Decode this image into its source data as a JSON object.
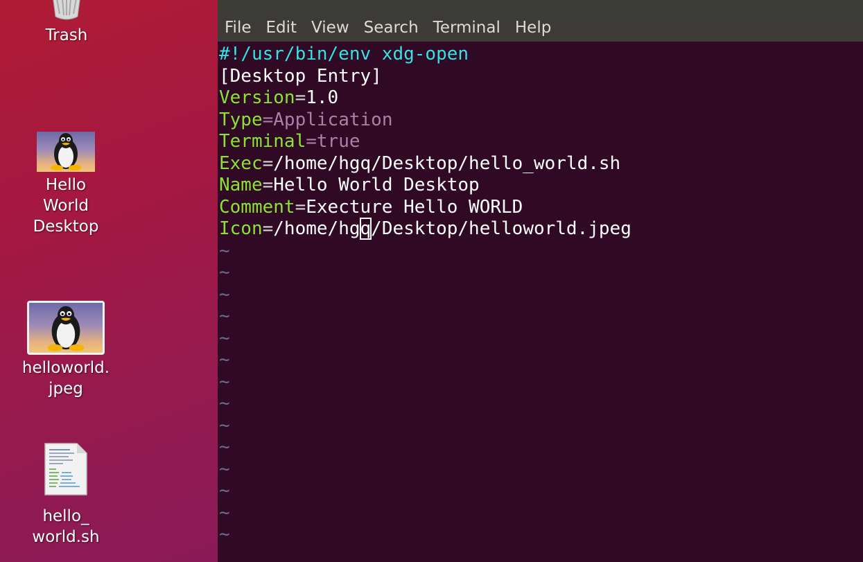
{
  "desktop": {
    "icons": [
      {
        "label": "Trash",
        "icon": "trash-icon"
      },
      {
        "label": "Hello\nWorld\nDesktop",
        "icon": "tux-icon"
      },
      {
        "label": "helloworld.\njpeg",
        "icon": "tux-icon"
      },
      {
        "label": "hello_\nworld.sh",
        "icon": "text-file-icon"
      }
    ]
  },
  "terminal": {
    "menu": [
      "File",
      "Edit",
      "View",
      "Search",
      "Terminal",
      "Help"
    ],
    "lines": [
      {
        "type": "shebang",
        "text": "#!/usr/bin/env xdg-open"
      },
      {
        "type": "plain",
        "text": "[Desktop Entry]"
      },
      {
        "type": "kv",
        "key": "Version",
        "value": "1.0"
      },
      {
        "type": "kv-purple",
        "key": "Type",
        "value": "Application"
      },
      {
        "type": "kv-purple",
        "key": "Terminal",
        "value": "true"
      },
      {
        "type": "kv",
        "key": "Exec",
        "value": "/home/hgq/Desktop/hello_world.sh"
      },
      {
        "type": "kv",
        "key": "Name",
        "value": "Hello World Desktop"
      },
      {
        "type": "kv",
        "key": "Comment",
        "value": "Execture Hello WORLD"
      },
      {
        "type": "kv-cursor",
        "key": "Icon",
        "value_before": "/home/hg",
        "cursor_char": "q",
        "value_after": "/Desktop/helloworld.jpeg"
      }
    ],
    "tilde": "~",
    "tilde_count": 14,
    "colors": {
      "background": "#300a24",
      "menubar": "#3c3b37",
      "shebang": "#34e2e2",
      "key": "#8ae234",
      "purple": "#ad7fa8"
    }
  }
}
